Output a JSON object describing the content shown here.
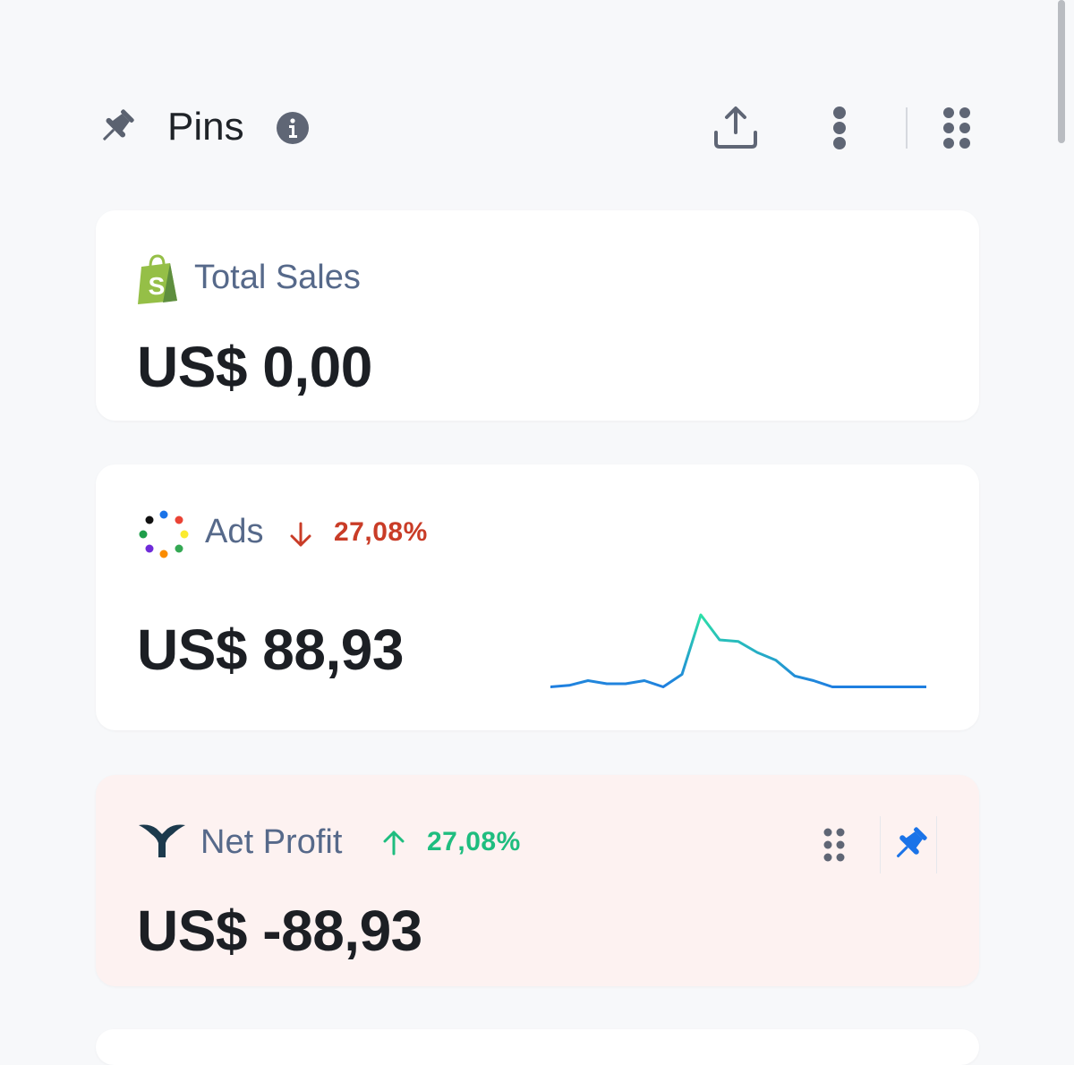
{
  "header": {
    "title": "Pins",
    "pin_icon": "pin-icon",
    "info_icon": "info-icon",
    "share_icon": "share-upload-icon",
    "more_icon": "more-vertical-icon",
    "grid_icon": "grid-dots-icon"
  },
  "cards": {
    "total_sales": {
      "label": "Total Sales",
      "value": "US$ 0,00",
      "icon": "shopify-bag-icon"
    },
    "ads": {
      "label": "Ads",
      "trend": "27,08%",
      "trend_direction": "down",
      "value": "US$ 88,93",
      "icon": "ads-dots-logo-icon",
      "sparkline": [
        2,
        3,
        6,
        4,
        4,
        6,
        2,
        10,
        48,
        32,
        31,
        24,
        19,
        9,
        6,
        2,
        2,
        2,
        2,
        2,
        2
      ]
    },
    "net_profit": {
      "label": "Net Profit",
      "trend": "27,08%",
      "trend_direction": "up",
      "value": "US$ -88,93",
      "icon": "triple-whale-logo-icon",
      "drag_icon": "drag-handle-icon",
      "pin_icon": "pin-icon"
    }
  },
  "colors": {
    "trend_down": "#c93c27",
    "trend_up": "#1ebd7f",
    "label": "#56698a",
    "pin_active": "#1a73e8",
    "profit_card_bg": "#fdf2f1"
  }
}
